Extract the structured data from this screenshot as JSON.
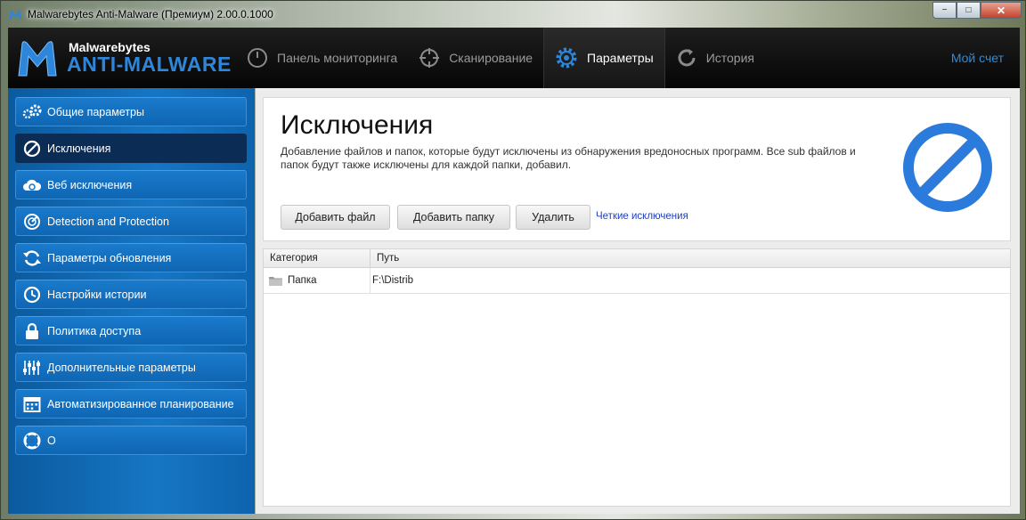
{
  "window": {
    "title": "Malwarebytes Anti-Malware (Премиум)  2.00.0.1000",
    "minimize": "−",
    "maximize": "□",
    "close": "✕"
  },
  "header": {
    "brand_top": "Malwarebytes",
    "brand_bottom": "ANTI-MALWARE",
    "nav": [
      {
        "label": "Панель мониторинга",
        "icon": "gauge-icon"
      },
      {
        "label": "Сканирование",
        "icon": "crosshair-icon"
      },
      {
        "label": "Параметры",
        "icon": "gear-icon"
      },
      {
        "label": "История",
        "icon": "history-icon"
      }
    ],
    "account": "Мой счет"
  },
  "sidebar": {
    "items": [
      {
        "label": "Общие параметры",
        "icon": "gears-icon"
      },
      {
        "label": "Исключения",
        "icon": "prohibited-icon"
      },
      {
        "label": "Веб исключения",
        "icon": "cloud-icon"
      },
      {
        "label": "Detection and Protection",
        "icon": "radar-icon"
      },
      {
        "label": "Параметры обновления",
        "icon": "refresh-icon"
      },
      {
        "label": "Настройки истории",
        "icon": "clock-icon"
      },
      {
        "label": "Политика доступа",
        "icon": "lock-icon"
      },
      {
        "label": "Дополнительные параметры",
        "icon": "sliders-icon"
      },
      {
        "label": "Автоматизированное планирование",
        "icon": "calendar-icon"
      },
      {
        "label": "О",
        "icon": "lifebuoy-icon"
      }
    ]
  },
  "main": {
    "title": "Исключения",
    "description": "Добавление файлов и папок, которые будут исключены из обнаружения вредоносных программ. Все sub файлов и папок будут также исключены для каждой папки, добавил.",
    "buttons": {
      "add_file": "Добавить файл",
      "add_folder": "Добавить папку",
      "delete": "Удалить"
    },
    "link": "Четкие исключения",
    "table": {
      "columns": [
        "Категория",
        "Путь"
      ],
      "rows": [
        {
          "category": "Папка",
          "path": "F:\\Distrib"
        }
      ]
    }
  },
  "colors": {
    "accent": "#2d86d9",
    "sidebar": "#1676c4",
    "sidebar_active": "#0a2c55",
    "header_bg": "#0a0a0a"
  }
}
